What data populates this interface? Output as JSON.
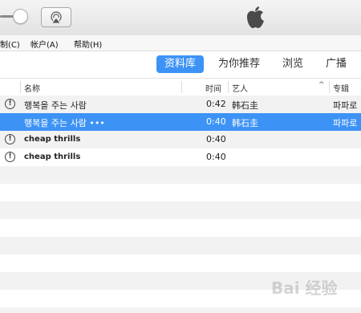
{
  "menu": {
    "items": [
      "制(C)",
      "帐户(A)",
      "帮助(H)"
    ]
  },
  "tabs": [
    {
      "label": "资料库",
      "active": true
    },
    {
      "label": "为你推荐",
      "active": false
    },
    {
      "label": "浏览",
      "active": false
    },
    {
      "label": "广播",
      "active": false
    }
  ],
  "columns": {
    "name": "名称",
    "time": "时间",
    "artist": "艺人",
    "album": "专辑"
  },
  "songs": [
    {
      "title": "행복을 주는 사람",
      "time": "0:42",
      "artist": "韩石圭",
      "album": "파파로",
      "warn": "!"
    },
    {
      "title": "행복을 주는 사람 •••",
      "time": "0:40",
      "artist": "韩石圭",
      "album": "파파로",
      "warn": ""
    },
    {
      "title": "cheap thrills",
      "time": "0:40",
      "artist": "",
      "album": "",
      "warn": "!"
    },
    {
      "title": "cheap thrills",
      "time": "0:40",
      "artist": "",
      "album": "",
      "warn": "!"
    }
  ],
  "watermark": {
    "text": "Bai 经验"
  },
  "colors": {
    "accent": "#3d93f5"
  }
}
